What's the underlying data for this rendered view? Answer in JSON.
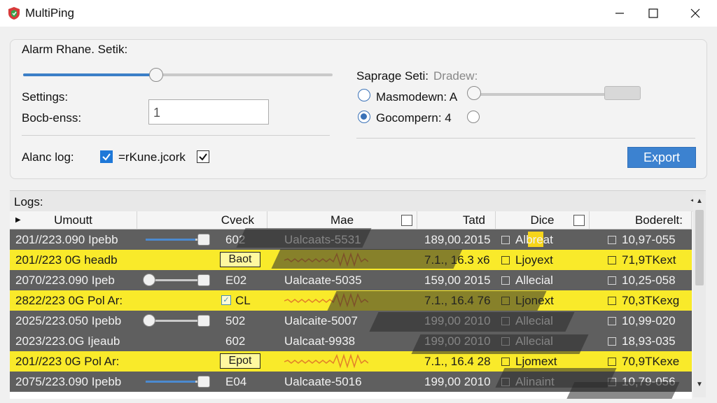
{
  "window": {
    "title": "MultiPing",
    "accent": "#3c82d0"
  },
  "settings": {
    "group_title": "Alarm Rhane. Setik:",
    "settings_label": "Settings:",
    "bocb_label": "Bocb-enss:",
    "input_value": "1",
    "alarm_log_label": "Alanc log:",
    "alarm_log_checked": true,
    "rkune_label": "=rKune.jcork",
    "rkune_checked": true,
    "top_slider_level": 0.43,
    "separage_label": "Saprage Seti:",
    "separage_hint": "Dradew:",
    "radio1_label": "Masmodewn: A",
    "radio1_selected": false,
    "radio2_label": "Gocompern: 4",
    "radio2_selected": true,
    "export_label": "Export"
  },
  "logs": {
    "title": "Logs:",
    "columns": [
      "Umoutt",
      "Cveck",
      "Mae",
      "Tatd",
      "Dice",
      "Boderelt:"
    ],
    "rows": [
      {
        "style": "gray",
        "c1": "201//223.090 Ipebb",
        "control": "slider-r",
        "slider_level": 0.85,
        "c2": "602",
        "c3": "Ualcaats-5531",
        "c4": "189,00.2015",
        "c5": "Albreat",
        "c6": "10,97-055"
      },
      {
        "style": "yellow",
        "c1": "201//223 0G headb",
        "control": "button",
        "button_label": "Baot",
        "c2": "",
        "c3": "",
        "c4": "7.1., 16.3 x6",
        "c5": "Ljoyext",
        "c6": "71,9TKext"
      },
      {
        "style": "gray",
        "c1": "2070/223.090 Ipeb",
        "control": "slider-c",
        "slider_level": 1.0,
        "c2": "E02",
        "c3": "Ualcaate-5035",
        "c4": "159,00 2015",
        "c5": "Allecial",
        "c6": "10,25-058"
      },
      {
        "style": "yellow",
        "c1": "2822/223 0G Pol Ar:",
        "control": "check",
        "c2": "CL",
        "c3": "",
        "c4": "7.1., 16.4 76",
        "c5": "Ljonext",
        "c6": "70,3TKexg"
      },
      {
        "style": "gray",
        "c1": "2025/223.050 Ipebb",
        "control": "slider-c",
        "slider_level": 1.0,
        "c2": "502",
        "c3": "Ualcaite-5007",
        "c4": "199,00 2010",
        "c5": "Allecial",
        "c6": "10,99-020"
      },
      {
        "style": "gray",
        "c1": "2023/223.0G Ijeaub",
        "control": "none",
        "c2": "602",
        "c3": "Ualcaat-9938",
        "c4": "199,00 2010",
        "c5": "Allecial",
        "c6": "18,93-035"
      },
      {
        "style": "yellow",
        "c1": "201//223 0G Pol Ar:",
        "control": "button",
        "button_label": "Epot",
        "c2": "",
        "c3": "",
        "c4": "7.1., 16.4 28",
        "c5": "Ljomext",
        "c6": "70,9TKexe"
      },
      {
        "style": "gray",
        "c1": "2075/223.090 Ipebb",
        "control": "slider-r",
        "slider_level": 0.85,
        "c2": "E04",
        "c3": "Ualcaate-5016",
        "c4": "199,00 2010",
        "c5": "Alinaint",
        "c6": "10,79-056"
      }
    ]
  }
}
